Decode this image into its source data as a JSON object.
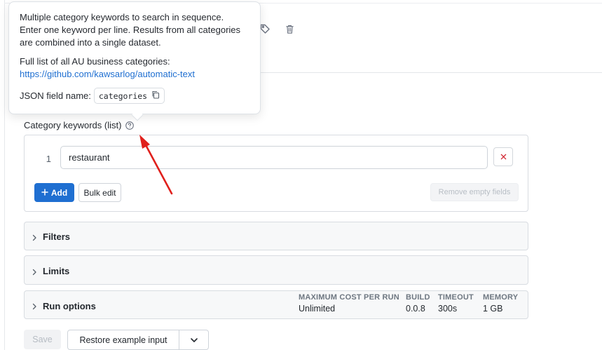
{
  "header": {
    "tag_icon": "tag-icon",
    "delete_icon": "trash-icon"
  },
  "tooltip": {
    "line1": "Multiple category keywords to search in sequence.",
    "line2": "Enter one keyword per line. Results from all categories",
    "line3": "are combined into a single dataset.",
    "list_text": "Full list of all AU business categories:",
    "link": "https://github.com/kawsarlog/automatic-text",
    "json_field_label": "JSON field name:",
    "json_field_value": "categories",
    "copy_icon": "copy-icon"
  },
  "field": {
    "label": "Category keywords (list)",
    "help_icon": "help-circle-icon",
    "rows": [
      {
        "index": "1",
        "value": "restaurant"
      }
    ],
    "add_label": "Add",
    "bulk_edit_label": "Bulk edit",
    "remove_empty_label": "Remove empty fields"
  },
  "sections": {
    "filters": "Filters",
    "limits": "Limits",
    "run_options": "Run options"
  },
  "run_stats": {
    "max_cost_label": "MAXIMUM COST PER RUN",
    "max_cost_value": "Unlimited",
    "build_label": "BUILD",
    "build_value": "0.0.8",
    "timeout_label": "TIMEOUT",
    "timeout_value": "300s",
    "memory_label": "MEMORY",
    "memory_value": "1 GB"
  },
  "footer": {
    "save_label": "Save",
    "restore_label": "Restore example input"
  },
  "colors": {
    "primary": "#1f6fd1",
    "danger": "#d1242f",
    "annotation_arrow": "#e0201c"
  }
}
